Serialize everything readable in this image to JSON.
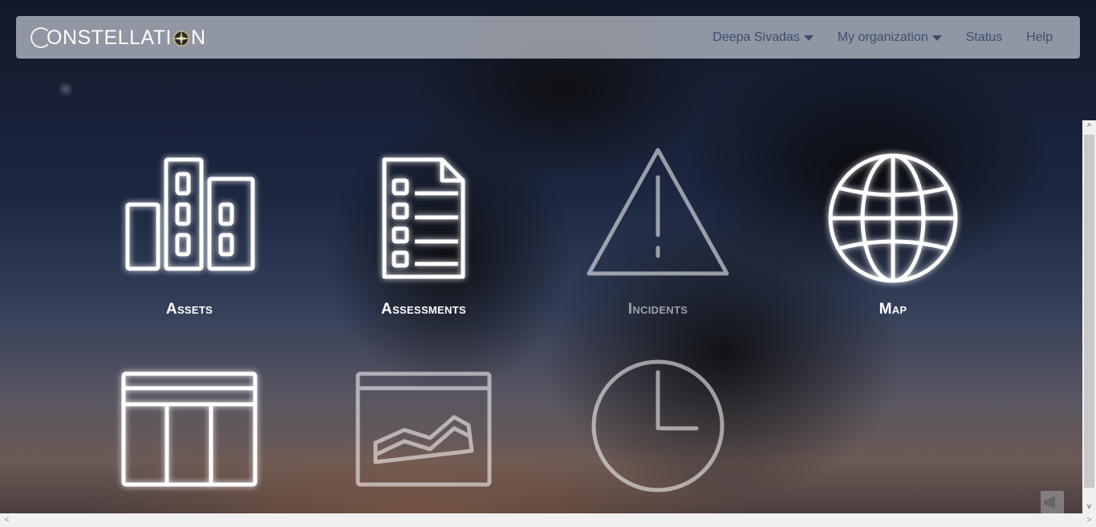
{
  "header": {
    "logo_text_before": "ONSTELLATI",
    "logo_text_after": "N",
    "user_menu": "Deepa Sivadas",
    "org_menu": "My organization",
    "status_link": "Status",
    "help_link": "Help"
  },
  "tiles": [
    {
      "label": "Assets",
      "icon": "buildings-icon",
      "enabled": true
    },
    {
      "label": "Assessments",
      "icon": "document-checklist-icon",
      "enabled": true
    },
    {
      "label": "Incidents",
      "icon": "warning-triangle-icon",
      "enabled": false
    },
    {
      "label": "Map",
      "icon": "globe-icon",
      "enabled": true
    },
    {
      "label": "",
      "icon": "table-icon",
      "enabled": true
    },
    {
      "label": "",
      "icon": "area-chart-icon",
      "enabled": false
    },
    {
      "label": "",
      "icon": "clock-icon",
      "enabled": false
    }
  ],
  "colors": {
    "nav_text": "#3d4f6f",
    "navbar_bg": "rgba(193,198,208,0.72)",
    "tile_text": "#ffffff"
  },
  "scrollbars": {
    "up_arrow": "^",
    "down_arrow": "v",
    "left_arrow": "<",
    "right_arrow": ">"
  },
  "feedback_icon": "megaphone-icon"
}
